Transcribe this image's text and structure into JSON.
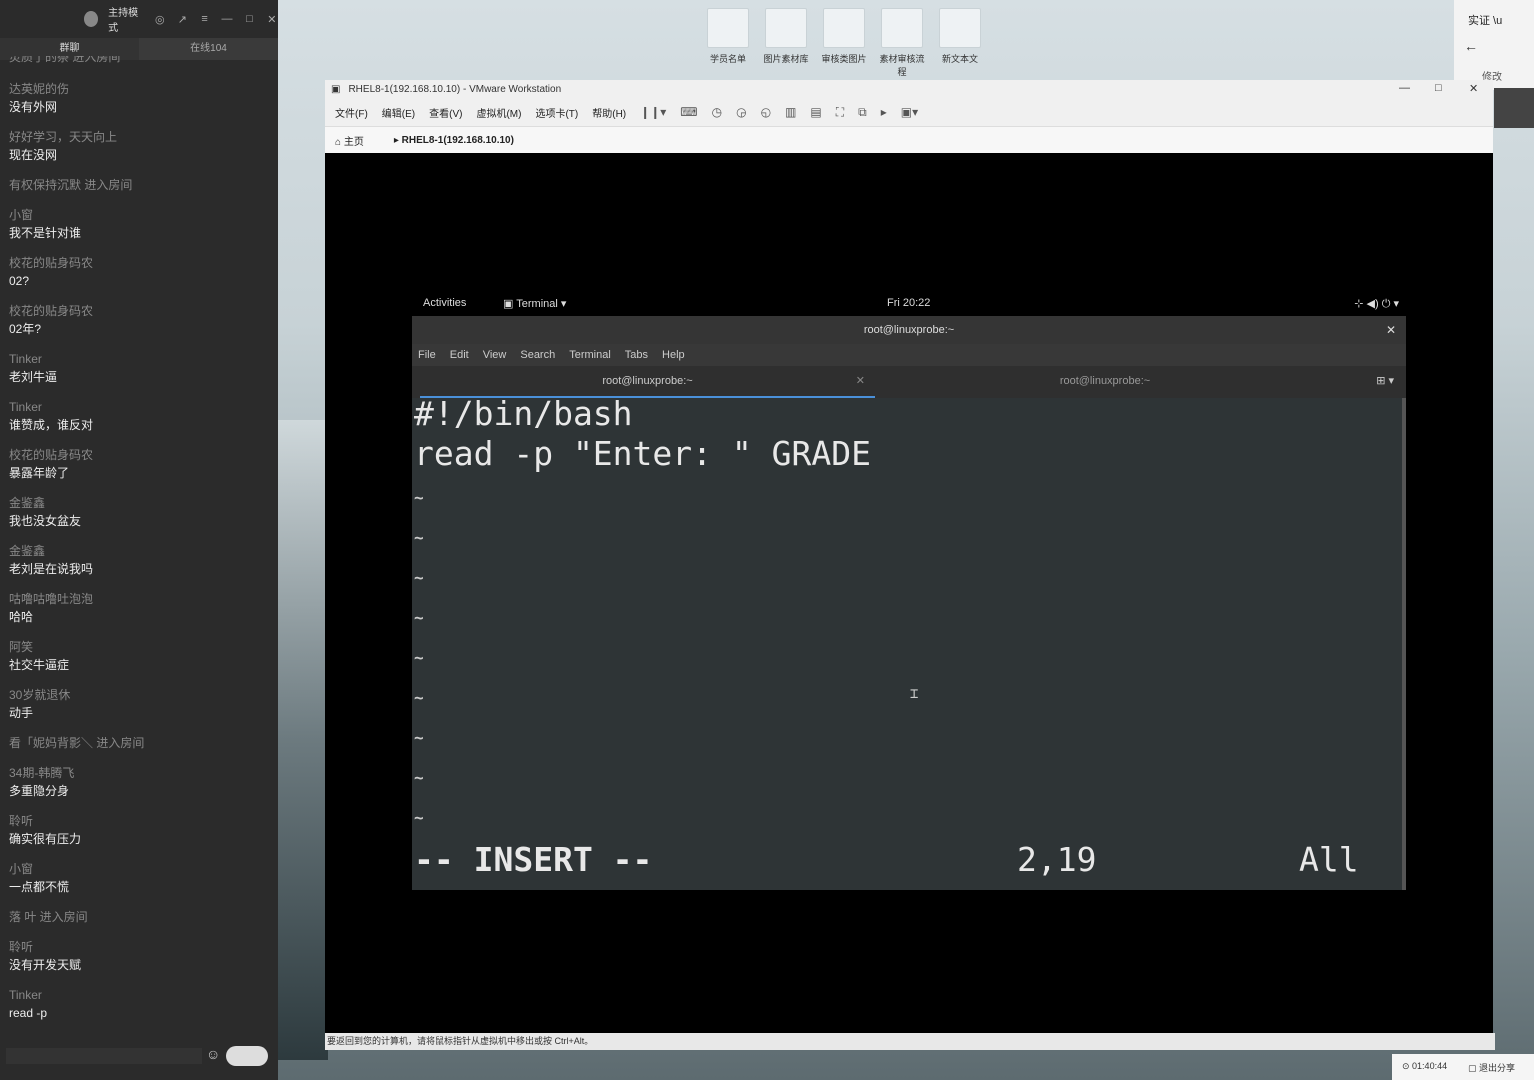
{
  "chat": {
    "title": "主持模式",
    "tabs": [
      "群聊",
      "在线104"
    ],
    "top_fragment": "灵质了的祭 进入房间",
    "items": [
      {
        "name": "达英妮的伤",
        "text": "没有外网"
      },
      {
        "name": "好好学习，天天向上",
        "text": "现在没网"
      },
      {
        "system": "有权保持沉默 进入房间"
      },
      {
        "name": "小窗",
        "text": "我不是针对谁"
      },
      {
        "name": "校花的贴身码农",
        "text": "02?"
      },
      {
        "name": "校花的贴身码农",
        "text": "02年?"
      },
      {
        "name": "Tinker",
        "text": "老刘牛逼"
      },
      {
        "name": "Tinker",
        "text": "谁赞成，谁反对"
      },
      {
        "name": "校花的贴身码农",
        "text": "暴露年龄了"
      },
      {
        "name": "金鉴鑫",
        "text": "我也没女盆友"
      },
      {
        "name": "金鉴鑫",
        "text": "老刘是在说我吗"
      },
      {
        "name": "咕噜咕噜吐泡泡",
        "text": "哈哈"
      },
      {
        "name": "阿笑",
        "text": "社交牛逼症"
      },
      {
        "name": "30岁就退休",
        "text": "动手"
      },
      {
        "system": "看「妮妈背影＼ 进入房间"
      },
      {
        "name": "34期-韩腾飞",
        "text": "多重隐分身"
      },
      {
        "name": "聆听",
        "text": "确实很有压力"
      },
      {
        "name": "小窗",
        "text": "一点都不慌"
      },
      {
        "system": "落  叶 进入房间"
      },
      {
        "name": "聆听",
        "text": "没有开发天赋"
      },
      {
        "name": "Tinker",
        "text": "read -p"
      }
    ]
  },
  "desktop_icons": [
    "学员名单",
    "图片素材库",
    "审核类图片",
    "素材审核流程",
    "新文本文"
  ],
  "right_panel": {
    "title": "实证 \\u",
    "sub": "修改"
  },
  "vmware": {
    "title": "RHEL8-1(192.168.10.10) - VMware Workstation",
    "menu": [
      "文件(F)",
      "编辑(E)",
      "查看(V)",
      "虚拟机(M)",
      "选项卡(T)",
      "帮助(H)"
    ],
    "tabs": [
      "主页",
      "RHEL8-1(192.168.10.10)"
    ],
    "status": "要返回到您的计算机，请将鼠标指针从虚拟机中移出或按 Ctrl+Alt。"
  },
  "gnome": {
    "activities": "Activities",
    "app": "Terminal ▾",
    "clock": "Fri 20:22"
  },
  "terminal": {
    "title": "root@linuxprobe:~",
    "menu": [
      "File",
      "Edit",
      "View",
      "Search",
      "Terminal",
      "Tabs",
      "Help"
    ],
    "tabs": [
      "root@linuxprobe:~",
      "root@linuxprobe:~"
    ],
    "lines": [
      "#!/bin/bash",
      "read -p \"Enter: \" GRADE"
    ],
    "mode": "-- INSERT --",
    "position": "2,19",
    "scroll": "All"
  },
  "share": {
    "time": "01:40:44",
    "exit": "退出分享"
  }
}
